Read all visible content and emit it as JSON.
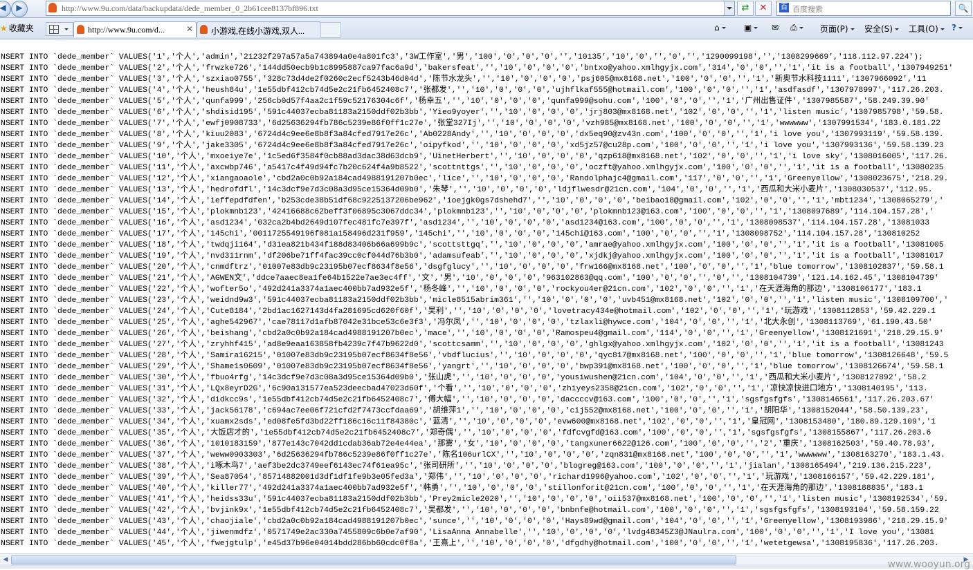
{
  "address_bar": {
    "url": "http://www.9u.com/data/backupdata/dede_member_0_2b61cee8137bf896.txt",
    "search_placeholder": "百度搜索"
  },
  "favorites_label": "收藏夹",
  "tabs": [
    {
      "label": "http://www.9u.com/d...",
      "active": true
    },
    {
      "label": "小游戏,在线小游戏,双人...",
      "active": false
    }
  ],
  "command_bar": {
    "page_label": "页面(P)",
    "safety_label": "安全(S)",
    "tools_label": "工具(O)"
  },
  "rows": [
    "NSERT INTO `dede_member` VALUES('1','个人','admin','21232f297a57a5a743894a0e4a801fc3','3W工作室','男','100','0','0','0','','10135','10','0','','0','','1290099198','','1308299669','118.112.97.224');",
    "NSERT INTO `dede_member` VALUES('2','个人','frwzke726','144dd50ecb9b1c8995887ca97fac6a9d','bakersfeat','','10','0','0','0','bntxo@yahoo.xmlhgyjx.com','314','0','0','','1','it is a football','1307949251'",
    "NSERT INTO `dede_member` VALUES('3','个人','szxiao0755','328c73d4de2f0260c2ecf5243b46d04d','陈节水龙头','','10','0','0','0','psj605@mx8168.net','100','0','0','','1','新奥节水科技1111','1307966092','11",
    "NSERT INTO `dede_member` VALUES('4','个人','heush84u','1e55dbf412cb74d5e2c21fb6452408c7','张都发','','10','0','0','0','ujhflkaf555@hotmail.com','100','0','0','','1','asdfasdf','1307978997','117.26.203.",
    "NSERT INTO `dede_member` VALUES('5','个人','qunfa999','256cb0d57f4aa2c1f59c52176304c6f','杨幸五','','10','0','0','0','qunfa999@sohu.com','100','0','0','','1','广州出售证件','1307985587','58.249.39.90'",
    "NSERT INTO `dede_member` VALUES('6','个人','shdisid195','591c44037ecba81183a2150ddf02b3bb','Yieo9yoyer','','10','0','0','0','jrj803@mx8168.net','102','0','0','','1','listen music','1307985798','59.58.",
    "NSERT INTO `dede_member` VALUES('7','个人','ewfj0908733','6d25636294fb786c5239e86f0ff1c27e','张堂327Ij','','10','0','0','0','vzh985@mx8168.net','100','0','0','','1','wwwwww','1307991534','183.0.181.22",
    "NSERT INTO `dede_member` VALUES('8','个人','kiuu2083','6724d4c9ee6e8b8f3a84cfed7917e26c','Ab0228Andy','','10','0','0','0','dx5eq90@zv43n.com','100','0','0','','1','i love you','1307993119','59.58.139.",
    "NSERT INTO `dede_member` VALUES('9','个人','jake3305','6724d4c9ee6e8b8f3a84cfed7917e26c','oipyfkod','','10','0','0','0','xd5jz57@cu28p.com','100','0','0','','1','i love you','1307993136','59.58.139.23",
    "NSERT INTO `dede_member` VALUES('10','个人','mxoeiye7e','1c5ed6f3584f0cb88ad3dac38d63dcb9','UinetHerbert','','10','0','0','0','qzp618@mx8168.net','102','0','0','','1','i love sky','1308016005','117.26.",
    "NSERT INTO `dede_member` VALUES('11','个人','axcwbp746','a5417c4f49d94fc7b20c624f4a9b8522','scottnttgs','','10','0','0','0','oczft@yahoo.xmlhgyjx.com','100','0','0','','1','it is a football','13080235",
    "NSERT INTO `dede_member` VALUES('12','个人','xiangaoaole','cbd2a0c0b92a184cad4988191207b0ec','lice','','10','0','0','0','Randolphajc4@gmail.com','117','0','0','','1','Greenyellow','1308023675','218.29.",
    "NSERT INTO `dede_member` VALUES('13','个人','hedrofdfl','14c3dcf9e7d3c08a3d95ce15364d09b0','朱琴','','10','0','0','0','ldjflwesdr@21cn.com','104','0','0','','1','西瓜和大米小麦片','1308030537','112.95.",
    "NSERT INTO `dede_member` VALUES('14','个人','ieffepdfdfen','b253cde38b51df68c9225137206be962','ioejgk0gs7dshehd7','','10','0','0','0','beibao18@gmail.com','102','0','0','','1','mbt1234','1308065279','",
    "NSERT INTO `dede_member` VALUES('15','个人','plokmnb123','42416688c62beff3f06895c3067ddc34','plokmnb123','','10','0','0','0','plokmnb123@163.com','100','0','0','','1','1308097689','114.104.157.28','",
    "NSERT INTO `dede_member` VALUES('16','个人','asd1234','032ca2b4bd2649d107fec481fc7e397f','asd1234','','10','0','0','0','asd1234@163.com','100','0','0','','1','1308098537','114.104.157.28','13081033",
    "NSERT INTO `dede_member` VALUES('17','个人','145chi','0011725549196f081a158496d231f959','145chi','','10','0','0','0','145chi@163.com','100','0','0','','1','1308098752','114.104.157.28','130810252",
    "NSERT INTO `dede_member` VALUES('18','个人','twdqji164','d31ea821b434f188d83406b66a699b9c','scottsttgq','','10','0','0','0','amrae@yahoo.xmlhgyjx.com','100','0','0','','1','it is a football','13081005",
    "NSERT INTO `dede_member` VALUES('19','个人','nvd311rnm','df206be71ff4fac39cc0cf044d76b3b0','adamsufeab','','10','0','0','0','xjdkj@yahoo.xmlhgyjx.com','100','0','0','','1','it is a football','13081017",
    "NSERT INTO `dede_member` VALUES('20','个人','cnmdftrz','01007e83db9c23195b07ecf8634f8e56','dsgfglucy','','10','0','0','0','frw166@mx8168.net','100','0','0','','1','blue tomorrow','1308102837','59.58.1",
    "NSERT INTO `dede_member` VALUES('21','个人','AGWEN文','ddce7aaec8ea1fe64b1522e7ae3ec4ff','文','男','10','0','0','0','963102863@qq.com','100','0','0','','0','','1308104739','121.14.162.45','1308104739'",
    "NSERT INTO `dede_member` VALUES('22','个人','wofter5o','492d241a3374a1aec400bb7ad932e5f','杨冬峰','','10','0','0','0','rockyou4er@21cn.com','102','0','0','','1','在天涯海角的那边','1308106177','183.1",
    "NSERT INTO `dede_member` VALUES('23','个人','weidnd9w3','591c44037ecba81183a2150ddf02b3bb','micle8515abrim361','','10','0','0','0','uvb451@mx8168.net','102','0','0','','1','listen music','1308109700','",
    "NSERT INTO `dede_member` VALUES('24','个人','Cute8184','2bd1ac1627143d4fa281695cd620f60f','吴利','','10','0','0','0','lovetracy434e@hotmail.com','102','0','0','','1','玩游戏','1308112853','59.42.229.1",
    "NSERT INTO `dede_member` VALUES('25','个人','aghe542967','cae78117d1afb87042e31bce53c6e3f3','冯尔凤','','10','0','0','0','tzlaxli@hywce.com','104','0','0','','1','北大永创','1308113769','61.190.43.50'",
    "NSERT INTO `dede_member` VALUES('26','个人','beishang','cbd2a0c0b92a184cad4988191207b0ec','mace','','10','0','0','0','Ramospeu4@gmail.com','114','0','0','','1','Greenyellow','1308121691','218.29.15.9'",
    "NSERT INTO `dede_member` VALUES('27','个人','zryhhf415','ad8e9eaa163858fb4239c7f47b9622d0','scottcsamm','','10','0','0','0','ghlgx@yahoo.xmlhgyjx.com','102','0','0','','1','it is a football','13081243",
    "NSERT INTO `dede_member` VALUES('28','个人','Samira16215','01007e83db9c23195b07ecf8634f8e56','vbdflucius','','10','0','0','0','qyc817@mx8168.net','100','0','0','','1','blue tomorrow','1308126648','59.5",
    "NSERT INTO `dede_member` VALUES('29','个人','Shame1s0609','01007e83db9c23195b07ecf8634f8e56','yangrt','','10','0','0','0','bwp391@mx8168.net','100','0','0','','1','blue tomorrow','1308126674','59.58.1",
    "NSERT INTO `dede_member` VALUES('30','个人','fbuo4rfg','14c3dcf9e7d3c08a3d95ce15364d09b0','张山虎','','10','0','0','0','yousiwushen@21cn.com','104','0','0','','1','西瓜和大米小麦片','1308127892','58.2",
    "NSERT INTO `dede_member` VALUES('31','个人','LQx8eyrD2G','6c90a131577ea523deecbad47023d60f','个看','','10','0','0','0','zhiyeys2358@21cn.com','102','0','0','','1','凉快凉快进口地方','1308140195','113.",
    "NSERT INTO `dede_member` VALUES('32','个人','didkcc9s','1e55dbf412cb74d5e2c21fb6452408c7','傅大幅','','10','0','0','0','daccccv@163.com','100','0','0','','1','sgsfgsfgfs','1308146561','117.26.203.67'",
    "NSERT INTO `dede_member` VALUES('33','个人','jack56178','c694ac7ee06f721cfd2f7473ccfdaa69','胡维萍1','','10','0','0','0','cij552@mx8168.net','100','0','0','','1','胡阳华','1308152044','58.50.139.23',",
    "NSERT INTO `dede_member` VALUES('34','个人','xuamx2sds','ed08fe5fd3bd22ff186c16c11f84380c','蓝清','','10','0','0','0','evw600@mx8168.net','102','0','0','','1','皇冠网','1308153480','180.89.129.109','1",
    "NSERT INTO `dede_member` VALUES('35','个人','大饭店才的','1e55dbf412cb74d5e2c21fb6452408c7','郑奇偶','','10','0','0','0','fdfcvgfd@163.com','100','0','0','','1','sgsfgsfgfs','1308155867','117.26.203.6",
    "NSERT INTO `dede_member` VALUES('36','个人','1010183159','877e143c7042dd1cdab36ab72e4e44ea','那雾','女','10','0','0','0','tangxuner6622@126.com','100','0','0','','2','重庆','1308162503','59.40.78.93',",
    "NSERT INTO `dede_member` VALUES('37','个人','weww0903303','6d25636294fb786c5239e86f0ff1c27e','陈名106urlCX','','10','0','0','0','zqn831@mx8168.net','100','0','0','','1','wwwwww','1308163270','183.1.43.",
    "NSERT INTO `dede_member` VALUES('38','个人','i啄木鸟7','aef3be2dc3749eef6143ec74f61ea95c','张司研所','','10','0','0','0','blogreg@163.com','100','0','0','','1','jialan','1308165494','219.136.215.223',",
    "NSERT INTO `dede_member` VALUES('39','个人','Sea87054','85714882001d3df1df1fe9b3e05fed3a','郑伟','','10','0','0','0','richard1996@yahoo.com','102','0','0','','1','玩游戏','1308166157','59.42.229.181',",
    "NSERT INTO `dede_member` VALUES('40','个人','killer77','492d241a3374a1aec400bb7ad932e5f','韩勇','','10','0','0','0','stillonforit@21cn.com','100','0','0','','1','在天涯海角的那边','1308188835','183.1",
    "NSERT INTO `dede_member` VALUES('41','个人','heidss33u','591c44037ecba81183a2150ddf02b3bb','Prey2micle2020','','10','0','0','0','oii537@mx8168.net','100','0','0','','1','listen music','1308192534','59.",
    "NSERT INTO `dede_member` VALUES('42','个人','bvjink9x','1e55dbf412cb74d5e2c21fb6452408c7','吴都发','','10','0','0','0','bnbnfe@hotmail.com','100','0','0','','1','sgsfgsfgfs','1308193104','59.58.159.22",
    "NSERT INTO `dede_member` VALUES('43','个人','chaojiale','cbd2a0c0b92a184cad4988191207b0ec','sunce','','10','0','0','0','Hays89wd@gmail.com','104','0','0','','1','Greenyellow','1308193986','218.29.15.9'",
    "NSERT INTO `dede_member` VALUES('44','个人','jiwenmdfz','0571749e2ac330a7455809c6b0e7af90','LisaAnna Annabelle','','10','0','0','0','lvdg48345Z3@JNaulra.com','100','0','0','','1','I love you','13081",
    "NSERT INTO `dede_member` VALUES('45','个人','fwejgtulp','e45d37b96e04014bdd286bb60cdc0f8a','王熹上','','10','0','0','0','dfgdhy@hotmail.com','100','0','0','','1','wetetgewsa','1308195836','117.26.203."
  ],
  "watermark": "www.wooyun.org"
}
